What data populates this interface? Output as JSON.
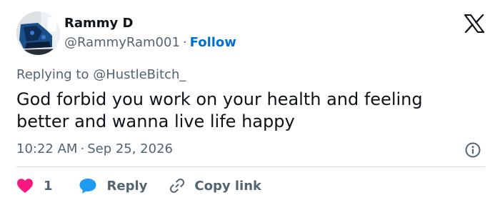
{
  "author": {
    "name": "Rammy D",
    "handle": "@RammyRam001",
    "separator": "·",
    "follow_label": "Follow"
  },
  "reply_context": {
    "prefix": "Replying to",
    "mention": "@HustleBitch_"
  },
  "tweet": {
    "text": "God forbid you work on your health and feeling better and wanna live life happy"
  },
  "meta": {
    "time": "10:22 AM",
    "separator": "·",
    "date": "Sep 25, 2026"
  },
  "actions": {
    "like_count": "1",
    "reply_label": "Reply",
    "copy_link_label": "Copy link"
  },
  "icons": {
    "brand": "x-logo-icon",
    "info": "info-icon",
    "like": "heart-icon",
    "reply": "speech-bubble-icon",
    "copy": "link-icon"
  },
  "colors": {
    "like": "#f91880",
    "reply": "#1d9bf0",
    "follow": "#006fd6",
    "secondary_text": "#536471",
    "primary_text": "#0f1419",
    "divider": "#cfd9de"
  }
}
